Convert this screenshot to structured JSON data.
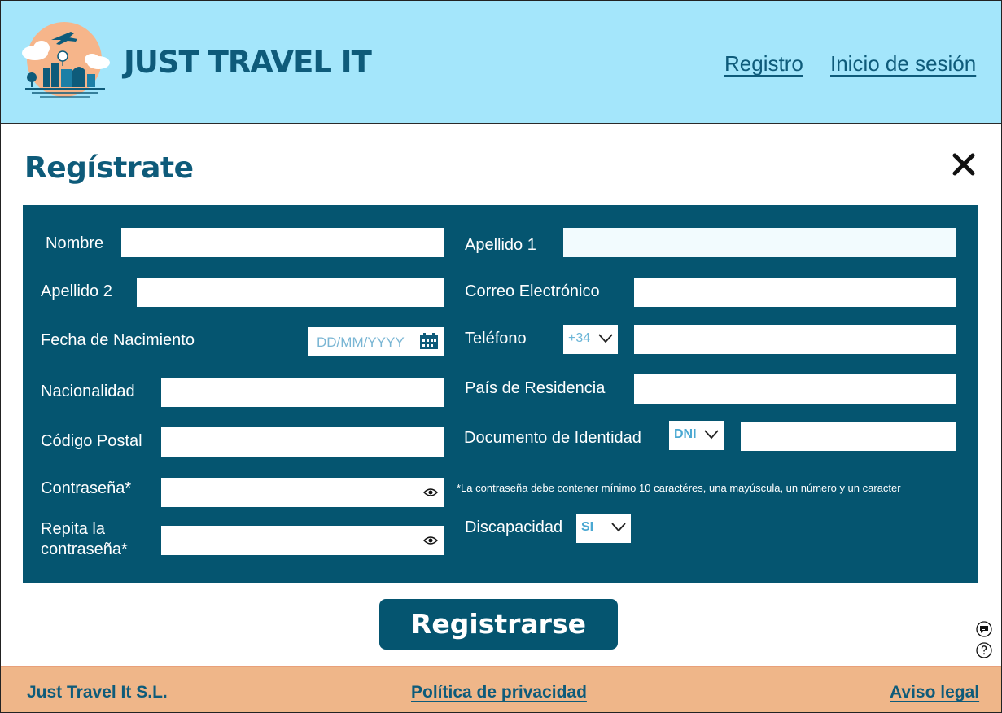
{
  "header": {
    "brand": "JUST TRAVEL IT",
    "nav": {
      "register": "Registro",
      "login": "Inicio de sesión"
    }
  },
  "page": {
    "title": "Regístrate"
  },
  "form": {
    "nombre": "Nombre",
    "apellido1": "Apellido 1",
    "apellido2": "Apellido 2",
    "correo": "Correo Electrónico",
    "fecha": "Fecha de Nacimiento",
    "fecha_placeholder": "DD/MM/YYYY",
    "telefono": "Teléfono",
    "telefono_prefix": "+34",
    "nacionalidad": "Nacionalidad",
    "pais": "País de Residencia",
    "codigo_postal": "Código Postal",
    "documento": "Documento de Identidad",
    "documento_tipo": "DNI",
    "contrasena": "Contraseña*",
    "contrasena_note": "*La contraseña debe contener mínimo 10 caractéres, una mayúscula, un número y un caracter",
    "repita_line1": "Repita la",
    "repita_line2": "contraseña*",
    "discapacidad": "Discapacidad",
    "discapacidad_val": "SI"
  },
  "submit": {
    "label": "Registrarse"
  },
  "footer": {
    "company": "Just Travel It S.L.",
    "privacy": "Política de privacidad",
    "legal": "Aviso legal"
  },
  "colors": {
    "header_bg": "#a4e6fb",
    "panel_bg": "#055570",
    "brand_text": "#0e5b7a",
    "footer_bg": "#efb689"
  },
  "icons": [
    "logo-airplane-city",
    "close-icon",
    "calendar-icon",
    "chevron-down-icon",
    "eye-icon",
    "chat-icon",
    "help-icon"
  ]
}
